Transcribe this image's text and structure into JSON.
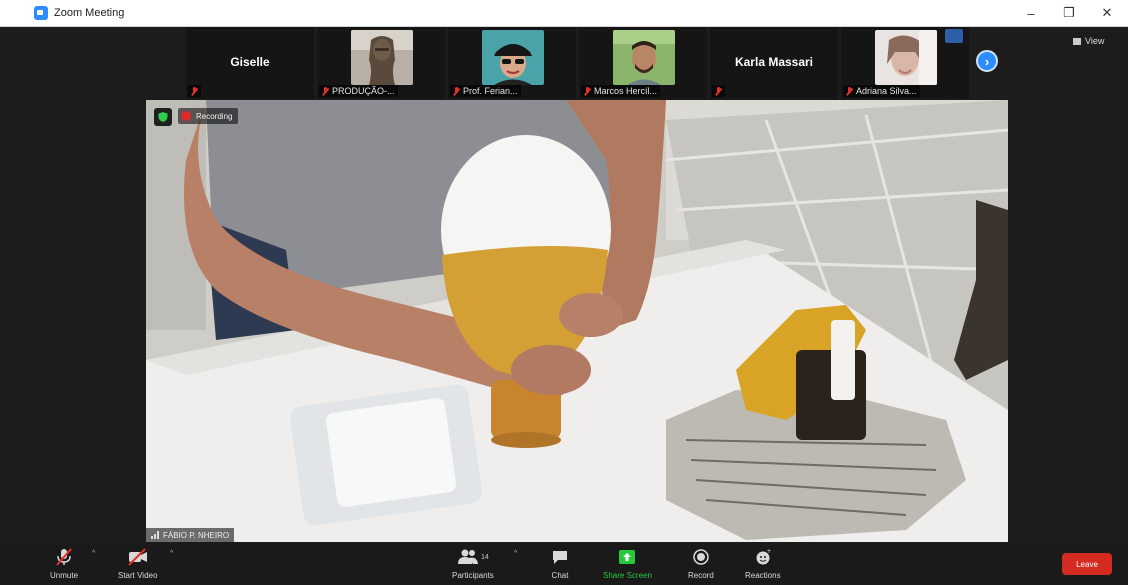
{
  "window": {
    "title": "Zoom Meeting",
    "controls": [
      "–",
      "❐",
      "✕"
    ]
  },
  "participants_strip": {
    "tiles": [
      {
        "name": "Giselle",
        "label": "",
        "has_video": false
      },
      {
        "name": "",
        "label": "PRODUÇÃO-...",
        "has_video": true,
        "thumb": "statue"
      },
      {
        "name": "",
        "label": "Prof. Ferian...",
        "has_video": true,
        "thumb": "woman"
      },
      {
        "name": "",
        "label": "Marcos Hercíl...",
        "has_video": true,
        "thumb": "man"
      },
      {
        "name": "Karla Massari",
        "label": "",
        "has_video": false
      },
      {
        "name": "",
        "label": "Adriana Silva...",
        "has_video": true,
        "thumb": "blur"
      }
    ],
    "next_icon": "chevron-right-icon",
    "view_label": "View"
  },
  "main_video": {
    "recording_label": "Recording",
    "speaker_label": "FÁBIO P. NHEIRO"
  },
  "toolbar": {
    "unmute_label": "Unmute",
    "start_video_label": "Start Video",
    "participants_label": "Participants",
    "participants_count": "14",
    "chat_label": "Chat",
    "share_label": "Share Screen",
    "record_label": "Record",
    "reactions_label": "Reactions",
    "leave_label": "Leave"
  },
  "colors": {
    "accent": "#2d8cff",
    "share_green": "#27c83c",
    "leave_red": "#d42a22",
    "muted_red": "#e0302a"
  }
}
